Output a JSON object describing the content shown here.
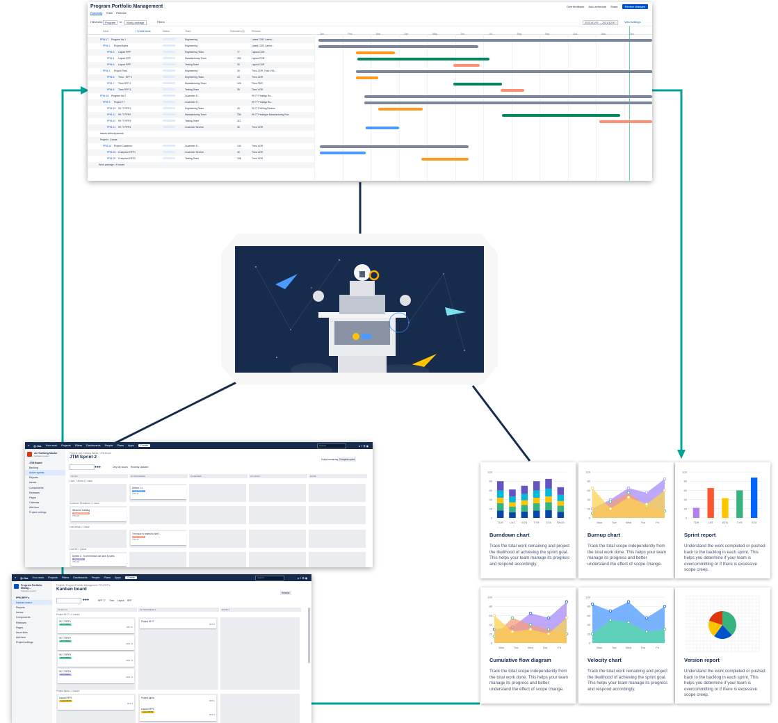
{
  "colors": {
    "connector_dark": "#172b4d",
    "connector_teal": "#00a19a",
    "brand_blue": "#0052cc"
  },
  "roadmap": {
    "title": "Program Portfolio Management",
    "tabs": [
      "Roadmap",
      "Team",
      "Release"
    ],
    "actions": [
      "Give feedback",
      "Auto-schedule",
      "Share",
      "Review changes"
    ],
    "filters": {
      "hierarchy_label": "Hierarchy:",
      "hierarchy_from": "Program",
      "to_label": "to",
      "hierarchy_to": "Work package",
      "filters_button": "Filters",
      "view_settings": "View settings",
      "date_range": "2021/01/01 – 2021/12/31"
    },
    "columns": [
      "Issue",
      "+ Create issue",
      "Status",
      "Team",
      "Estimates (d)",
      "Release"
    ],
    "timeline_months": [
      "Jan",
      "Feb",
      "Mar",
      "Apr",
      "May",
      "Jun",
      "Jul",
      "Aug",
      "Sep",
      "Oct",
      "Nov",
      "Dec"
    ],
    "rows": [
      {
        "key": "PPM-17",
        "summary": "Program No 1",
        "team": "Engineering",
        "release": "Latest CDR, Latest..."
      },
      {
        "key": "PPM-1",
        "summary": "Project Alpha",
        "team": "Engineering",
        "release": "Latest CDR, Latest..."
      },
      {
        "key": "PPM-3",
        "summary": "Layout RFP",
        "team": "Engineering Team",
        "est": "77",
        "release": "Layout CDR"
      },
      {
        "key": "PPM-4",
        "summary": "Layout RFP",
        "team": "Manufacturing Team",
        "est": "290",
        "release": "Layout PDR"
      },
      {
        "key": "PPM-5",
        "summary": "Layout RFP",
        "team": "Testing Team",
        "est": "30",
        "release": "Layout CDR"
      },
      {
        "key": "PPM-2",
        "summary": "Project Theo",
        "team": "Engineering",
        "est": "30",
        "release": "Theo CDR, Theo VOL..."
      },
      {
        "key": "PPM-6",
        "summary": "Theo - RFP 1",
        "team": "Engineering Team",
        "est": "43",
        "release": "Theo CDR"
      },
      {
        "key": "PPM-7",
        "summary": "Theo RFP 2",
        "team": "Manufacturing Team",
        "est": "126",
        "release": "Theo PDR"
      },
      {
        "key": "PPM-8",
        "summary": "Theo RFP 3",
        "team": "Testing Team",
        "est": "35",
        "release": "Theo VOR"
      },
      {
        "key": "PPM-18",
        "summary": "Program No 2",
        "team": "Customer S...",
        "release": "99 77 Prototyp Ru..."
      },
      {
        "key": "PPM-9",
        "summary": "Project 77",
        "team": "Customer S...",
        "release": "99 77 Prototyp Ru..."
      },
      {
        "key": "PPM-10",
        "summary": "99 77 RFP1",
        "team": "Engineering Team",
        "est": "49",
        "release": "99 77 PrtCling Review"
      },
      {
        "key": "PPM-11",
        "summary": "99 77 RFP2",
        "team": "Manufacturing Team",
        "est": "230",
        "release": "99 77 Prototype Manufacturing Run"
      },
      {
        "key": "PPM-12",
        "summary": "99 77 RFP3",
        "team": "Testing Team",
        "est": "112",
        "release": ""
      },
      {
        "key": "PPM-21",
        "summary": "99 77 RFP4",
        "team": "Customer Service",
        "est": "35",
        "release": "Theo VOR"
      },
      {
        "key": "",
        "summary": "Issues without parents",
        "team": "",
        "release": ""
      },
      {
        "key": "",
        "summary": "Project • 1 Issue",
        "team": "",
        "release": ""
      },
      {
        "key": "PPM-14",
        "summary": "Project Crazimon",
        "team": "Customer S...",
        "est": "144",
        "release": "Theo VOR"
      },
      {
        "key": "PPM-19",
        "summary": "Crazymon RFP1",
        "team": "Customer Service",
        "est": "46",
        "release": "Theo VOR"
      },
      {
        "key": "PPM-20",
        "summary": "Crazymon RFP2",
        "team": "Testing Team",
        "est": "108",
        "release": "Theo VOR"
      },
      {
        "key": "",
        "summary": "Work package • 4 issues",
        "team": "",
        "release": ""
      }
    ]
  },
  "sprint_board": {
    "nav": [
      "Your work",
      "Projects",
      "Filters",
      "Dashboards",
      "People",
      "Plans",
      "Apps"
    ],
    "create": "Create",
    "search": "Search",
    "project": "Air Trafiking Master",
    "project_sub": "Software project",
    "sidebar_group": "JTM Board",
    "sidebar_group_sub": "Board",
    "sidebar": [
      "Backlog",
      "Active sprints",
      "Reports",
      "Issues",
      "Components",
      "Releases",
      "Pages",
      "Calendar",
      "Add item",
      "Project settings"
    ],
    "breadcrumb": "Projects / Air Trafiking Master / JTM Board",
    "title": "JTM Sprint 2",
    "controls": [
      "Only My Issues",
      "Recently Updated"
    ],
    "days_remaining": "5 days remaining",
    "complete_sprint": "Complete sprint",
    "columns": [
      "TO DO",
      "IN PROGRESS",
      "IN REVIEW",
      "ON HOLD",
      "DONE"
    ],
    "lanes": [
      "Lost • 7 Aliens • 1 issue",
      "Customer Reclaimed • 1 issue",
      "Lost Arrival • 1 issue",
      "Lost Hill • 1 issue"
    ],
    "cards": [
      {
        "title": "Deliver 1.1",
        "tag": "Stack Rollout",
        "key": "JTM-11"
      },
      {
        "title": "Welcome building",
        "tag": "Jugnoo Dynamics",
        "key": "JTM-15"
      },
      {
        "title": "The issue is related to kim 1",
        "tag": "Issue related",
        "key": "JTM-12"
      },
      {
        "title": "Sprints 1 - To emit bleach can lace 4 points",
        "tag": "Daily Nodes",
        "key": "JTM-16"
      }
    ]
  },
  "kanban_board": {
    "project": "Program Portfolio Manag...",
    "project_sub": "Software project",
    "sidebar_group": "PPM RFP's",
    "sidebar_group_sub": "Board",
    "sidebar": [
      "Kanban board",
      "Reports",
      "Issues",
      "Components",
      "Releases",
      "Pages",
      "Issue links",
      "Add item",
      "Project settings"
    ],
    "breadcrumb": "Projects / Program Portfolio Management / PPM RFP's",
    "title": "Kanban board",
    "controls": [
      "RFP 77",
      "Theo",
      "Layout",
      "RFP"
    ],
    "release": "Release",
    "columns": [
      "TO DO 74",
      "IN PROGRESS 1",
      "DONE 1"
    ],
    "lane1": "Project 99 77 • 4 issues",
    "lane2": "Project Alpha • 2 issues",
    "cards": [
      {
        "title": "99 77 RFP1",
        "tag": "99 77 RFP1",
        "key": "RFP 11"
      },
      {
        "title": "99 77 RFP2",
        "tag": "99 77 RFP2",
        "key": "RFP 12"
      },
      {
        "title": "99 77 RFP3",
        "tag": "99 77 RFP3",
        "key": "RFP 13"
      },
      {
        "title": "99 77 RFP4",
        "tag": "99 77 RFP4",
        "key": "RFP 14"
      },
      {
        "title": "Project 99 77",
        "tag": "",
        "key": "RFP 9"
      },
      {
        "title": "Layout RFP1",
        "tag": "Layout RFP1",
        "key": "RFP 3"
      },
      {
        "title": "Project Alpha",
        "tag": "",
        "key": "RFP 1"
      },
      {
        "title": "Layout RFP2",
        "tag": "Layout RFP2",
        "key": "RFP 4"
      }
    ]
  },
  "reports": [
    {
      "title": "Burndown chart",
      "desc": "Track the total work remaining and project the likelihood of achieving the sprint goal. This helps your team manage its progress and respond accordingly."
    },
    {
      "title": "Burnup chart",
      "desc": "Track the total scope independently from the total work done. This helps your team manage its progress and better understand the effect of scope change."
    },
    {
      "title": "Sprint report",
      "desc": "Understand the work completed or pushed back to the backlog in each sprint. This helps you determine if your team is overcommitting or if there is excessive scope creep."
    },
    {
      "title": "Cumulative flow diagram",
      "desc": "Track the total scope independently from the total work done. This helps your team manage its progress and better understand the effect of scope change."
    },
    {
      "title": "Velocity chart",
      "desc": "Track the total work remaining and project the likelihood of achieving the sprint goal. This helps your team manage its progress and respond accordingly."
    },
    {
      "title": "Version report",
      "desc": "Understand the work completed or pushed back to the backlog in each sprint. This helps you determine if your team is overcommitting or if there is excessive scope creep."
    }
  ],
  "chart_data": [
    {
      "type": "bar",
      "title": "Burndown chart",
      "categories": [
        "TDR",
        "LNT",
        "BTN",
        "TYR",
        "STA",
        "PAGS"
      ],
      "ylim": [
        0,
        100
      ],
      "yticks": [
        0,
        20,
        40,
        60,
        80,
        100
      ],
      "series": [
        {
          "values": [
            80,
            62,
            70,
            80,
            85,
            67
          ]
        }
      ]
    },
    {
      "type": "area",
      "title": "Burnup chart",
      "categories": [
        "Mon",
        "Tue",
        "Wed",
        "Thu",
        "Fri"
      ],
      "ylim": [
        0,
        100
      ],
      "yticks": [
        0,
        20,
        40,
        60,
        80,
        100
      ]
    },
    {
      "type": "bar",
      "title": "Sprint report",
      "categories": [
        "TDR",
        "LNT",
        "BTN",
        "TYR",
        "STA"
      ],
      "ylim": [
        0,
        100
      ],
      "yticks": [
        0,
        20,
        40,
        60,
        80,
        100
      ],
      "series": [
        {
          "values": [
            22,
            65,
            43,
            60,
            88
          ]
        }
      ]
    },
    {
      "type": "area",
      "title": "Cumulative flow diagram",
      "categories": [
        "Mon",
        "Tue",
        "Wed",
        "Thu",
        "Fri"
      ],
      "ylim": [
        0,
        100
      ],
      "yticks": [
        0,
        20,
        40,
        60,
        80,
        100
      ]
    },
    {
      "type": "area",
      "title": "Velocity chart",
      "categories": [
        "Mon",
        "Tue",
        "Wed",
        "Thu",
        "Fri"
      ],
      "ylim": [
        0,
        100
      ],
      "yticks": [
        0,
        20,
        40,
        60,
        80,
        100
      ]
    },
    {
      "type": "pie",
      "title": "Version report",
      "series": [
        {
          "values": [
            38,
            22,
            20,
            20
          ]
        }
      ]
    }
  ]
}
